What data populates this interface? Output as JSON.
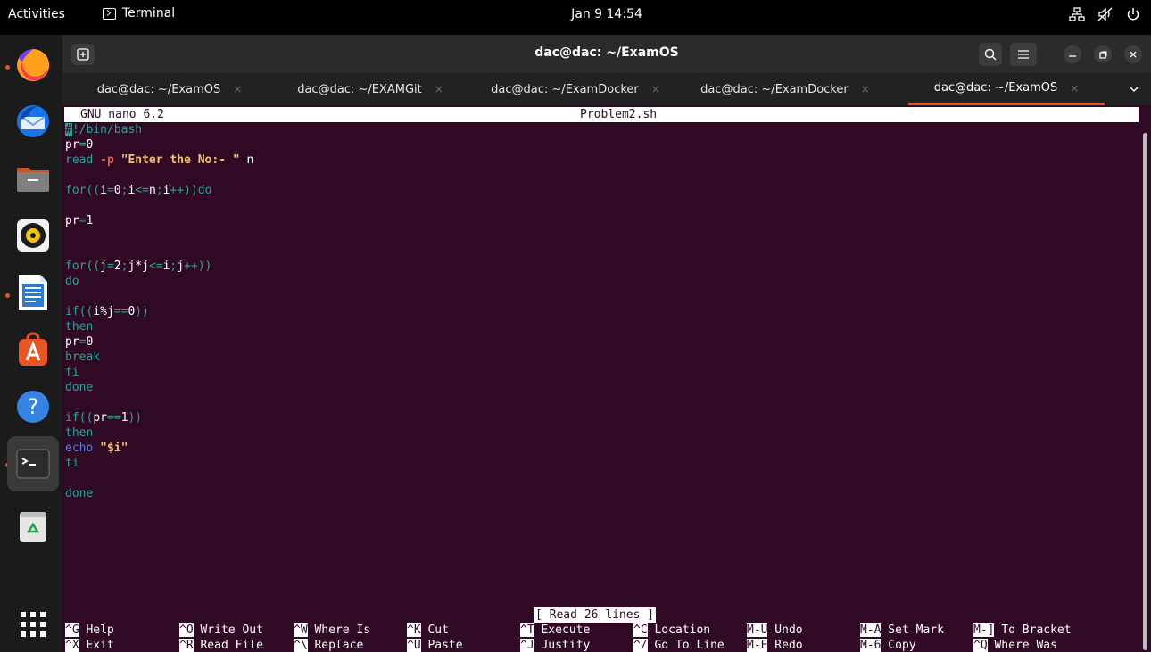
{
  "topbar": {
    "activities": "Activities",
    "app_name": "Terminal",
    "clock": "Jan 9  14:54"
  },
  "window": {
    "title": "dac@dac: ~/ExamOS",
    "tabs": [
      {
        "label": "dac@dac: ~/ExamOS",
        "active": false
      },
      {
        "label": "dac@dac: ~/EXAMGit",
        "active": false
      },
      {
        "label": "dac@dac: ~/ExamDocker",
        "active": false
      },
      {
        "label": "dac@dac: ~/ExamDocker",
        "active": false
      },
      {
        "label": "dac@dac: ~/ExamOS",
        "active": true
      }
    ]
  },
  "nano": {
    "version": "GNU nano 6.2",
    "filename": "Problem2.sh",
    "status": "[ Read 26 lines ]",
    "lines": [
      "#!/bin/bash",
      "pr=0",
      "read -p \"Enter the No:- \" n",
      "",
      "for((i=0;i<=n;i++))do",
      "",
      "pr=1",
      "",
      "",
      "for((j=2;j*j<=i;j++))",
      "do",
      "",
      "if((i%j==0))",
      "then",
      "pr=0",
      "break",
      "fi",
      "done",
      "",
      "if((pr==1))",
      "then",
      "echo \"$i\"",
      "fi",
      "",
      "done"
    ],
    "shortcuts_row1": [
      {
        "key": "^G",
        "label": "Help"
      },
      {
        "key": "^O",
        "label": "Write Out"
      },
      {
        "key": "^W",
        "label": "Where Is"
      },
      {
        "key": "^K",
        "label": "Cut"
      },
      {
        "key": "^T",
        "label": "Execute"
      },
      {
        "key": "^C",
        "label": "Location"
      },
      {
        "key": "M-U",
        "label": "Undo"
      },
      {
        "key": "M-A",
        "label": "Set Mark"
      },
      {
        "key": "M-]",
        "label": "To Bracket"
      }
    ],
    "shortcuts_row2": [
      {
        "key": "^X",
        "label": "Exit"
      },
      {
        "key": "^R",
        "label": "Read File"
      },
      {
        "key": "^\\",
        "label": "Replace"
      },
      {
        "key": "^U",
        "label": "Paste"
      },
      {
        "key": "^J",
        "label": "Justify"
      },
      {
        "key": "^/",
        "label": "Go To Line"
      },
      {
        "key": "M-E",
        "label": "Redo"
      },
      {
        "key": "M-6",
        "label": "Copy"
      },
      {
        "key": "^Q",
        "label": "Where Was"
      }
    ]
  },
  "colors": {
    "terminal_bg": "#300a24",
    "accent": "#e95420"
  },
  "icons": [
    "firefox-icon",
    "thunderbird-icon",
    "files-icon",
    "rhythmbox-icon",
    "libreoffice-writer-icon",
    "app-center-icon",
    "help-icon",
    "terminal-icon",
    "trash-icon",
    "show-apps-icon"
  ]
}
